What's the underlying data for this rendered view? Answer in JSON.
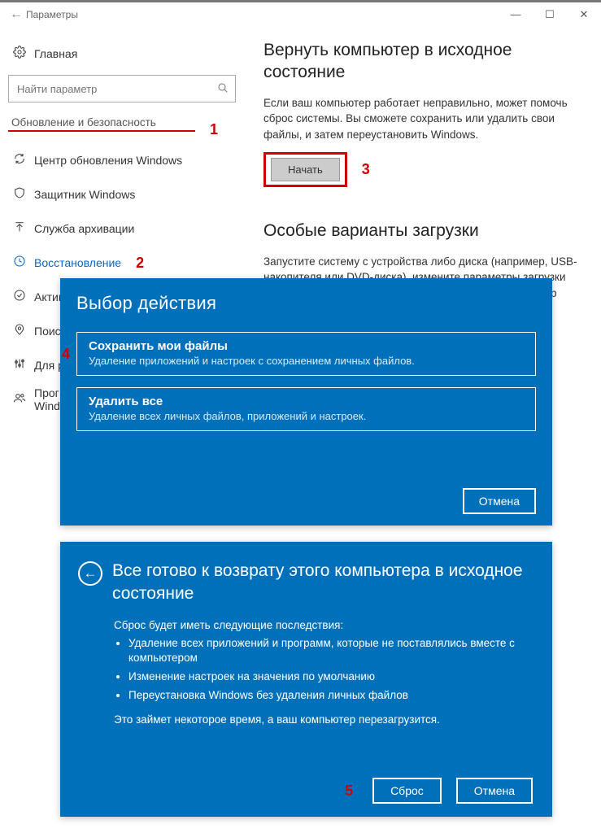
{
  "window": {
    "title": "Параметры"
  },
  "sidebar": {
    "home": "Главная",
    "search_placeholder": "Найти параметр",
    "section": "Обновление и безопасность",
    "items": [
      {
        "icon": "sync",
        "label": "Центр обновления Windows"
      },
      {
        "icon": "shield",
        "label": "Защитник Windows"
      },
      {
        "icon": "upload",
        "label": "Служба архивации"
      },
      {
        "icon": "clock",
        "label": "Восстановление",
        "active": true
      },
      {
        "icon": "check",
        "label": "Актив"
      },
      {
        "icon": "map",
        "label": "Поис"
      },
      {
        "icon": "sliders",
        "label": "Для р"
      },
      {
        "icon": "people",
        "label": "Прог\nWind"
      }
    ]
  },
  "annotations": {
    "a1": "1",
    "a2": "2",
    "a3": "3",
    "a4": "4",
    "a5": "5"
  },
  "main": {
    "reset_title": "Вернуть компьютер в исходное состояние",
    "reset_desc": "Если ваш компьютер работает неправильно, может помочь сброс системы. Вы сможете сохранить или удалить свои файлы, и затем переустановить Windows.",
    "begin_btn": "Начать",
    "advanced_title": "Особые варианты загрузки",
    "advanced_desc": "Запустите систему с устройства либо диска (например, USB-накопителя или DVD-диска), измените параметры загрузки Windows или восстановите ее из образа. Ваш компьютер"
  },
  "dialog_choice": {
    "title": "Выбор действия",
    "option_keep_title": "Сохранить мои файлы",
    "option_keep_sub": "Удаление приложений и настроек с сохранением личных файлов.",
    "option_remove_title": "Удалить все",
    "option_remove_sub": "Удаление всех личных файлов, приложений и настроек.",
    "cancel": "Отмена"
  },
  "dialog_ready": {
    "title": "Все готово к возврату этого компьютера в исходное состояние",
    "intro": "Сброс будет иметь следующие последствия:",
    "bullets": [
      "Удаление всех приложений и программ, которые не поставлялись вместе с компьютером",
      "Изменение настроек на значения по умолчанию",
      "Переустановка Windows без удаления личных файлов"
    ],
    "outro": "Это займет некоторое время, а ваш компьютер перезагрузится.",
    "reset_btn": "Сброс",
    "cancel": "Отмена"
  }
}
